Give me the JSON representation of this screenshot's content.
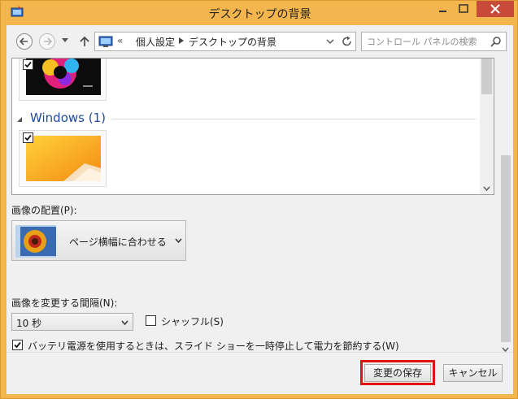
{
  "window": {
    "title": "デスクトップの背景"
  },
  "address_bar": {
    "overflow": "«",
    "crumbs": [
      "個人設定",
      "デスクトップの背景"
    ]
  },
  "search": {
    "placeholder": "コントロール パネルの検索"
  },
  "gallery": {
    "group_label": "Windows (1)",
    "tiles": [
      {
        "checked": true,
        "theme": "colorful splash"
      },
      {
        "checked": true,
        "theme": "yellow-orange windows"
      }
    ]
  },
  "picture_position": {
    "label": "画像の配置(P):",
    "value": "ページ横幅に合わせる"
  },
  "interval": {
    "label": "画像を変更する間隔(N):",
    "value": "10 秒"
  },
  "shuffle": {
    "label": "シャッフル(S)",
    "checked": false
  },
  "battery": {
    "label": "バッテリ電源を使用するときは、スライド ショーを一時停止して電力を節約する(W)",
    "checked": true
  },
  "buttons": {
    "save": "変更の保存",
    "cancel": "キャンセル"
  },
  "colors": {
    "title_bar": "#f3b54d",
    "close_button": "#c74a3a",
    "group_label": "#1f4a9c",
    "highlight": "#e01212"
  }
}
